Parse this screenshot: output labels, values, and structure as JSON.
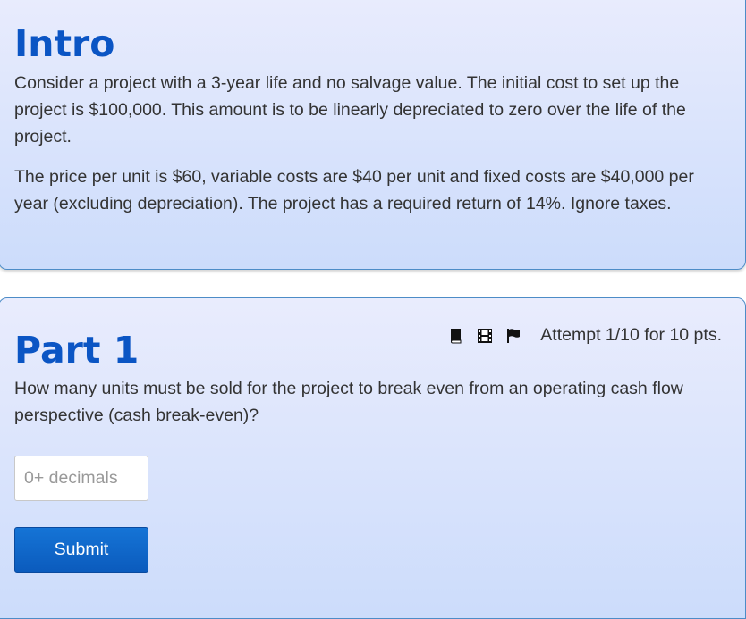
{
  "intro": {
    "title": "Intro",
    "paragraph1": "Consider a project with a 3-year life and no salvage value. The initial cost to set up the project is $100,000. This amount is to be linearly depreciated to zero over the life of the project.",
    "paragraph2": "The price per unit is $60, variable costs are $40 per unit and fixed costs are $40,000 per year (excluding depreciation). The project has a required return of 14%. Ignore taxes."
  },
  "part1": {
    "title": "Part 1",
    "attempt_text": "Attempt 1/10 for 10 pts.",
    "icons": [
      "book-icon",
      "film-icon",
      "flag-icon"
    ],
    "question": "How many units must be sold for the project to break even from an operating cash flow perspective (cash break-even)?",
    "answer_value": "",
    "answer_placeholder": "0+ decimals",
    "submit_label": "Submit"
  },
  "colors": {
    "heading": "#0b55c4",
    "card_gradient_top": "#e9ecfd",
    "card_gradient_bottom": "#ccdcfb",
    "card_border": "#4d8cc7",
    "button": "#0b5bbd",
    "text": "#333333"
  }
}
